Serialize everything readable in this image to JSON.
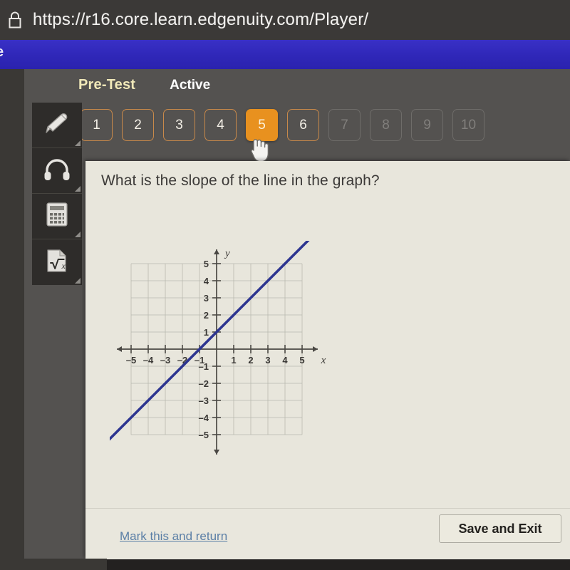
{
  "browser": {
    "url": "https://r16.core.learn.edgenuity.com/Player/",
    "lock_icon": "lock-icon"
  },
  "banner": {
    "cutoff_text": "e"
  },
  "test_header": {
    "title": "Pre-Test",
    "status": "Active"
  },
  "question_nav": {
    "items": [
      {
        "label": "1",
        "state": "available"
      },
      {
        "label": "2",
        "state": "available"
      },
      {
        "label": "3",
        "state": "available"
      },
      {
        "label": "4",
        "state": "available"
      },
      {
        "label": "5",
        "state": "current"
      },
      {
        "label": "6",
        "state": "available"
      },
      {
        "label": "7",
        "state": "locked"
      },
      {
        "label": "8",
        "state": "locked"
      },
      {
        "label": "9",
        "state": "locked"
      },
      {
        "label": "10",
        "state": "locked"
      }
    ],
    "current_index": 4
  },
  "tools": [
    {
      "name": "pencil-tool",
      "icon": "pencil-icon"
    },
    {
      "name": "audio-tool",
      "icon": "headphones-icon"
    },
    {
      "name": "calculator-tool",
      "icon": "calculator-icon"
    },
    {
      "name": "formula-tool",
      "icon": "square-root-icon"
    }
  ],
  "question": {
    "text": "What is the slope of the line in the graph?"
  },
  "footer": {
    "mark_link": "Mark this and return",
    "save_button": "Save and Exit"
  },
  "colors": {
    "accent_orange": "#e8911f",
    "banner_blue": "#2f27b8",
    "line_blue": "#2d3590",
    "link_blue": "#5b7fa6"
  },
  "chart_data": {
    "type": "line",
    "title": "",
    "xlabel": "x",
    "ylabel": "y",
    "xlim": [
      -5,
      5
    ],
    "ylim": [
      -5,
      5
    ],
    "grid": true,
    "legend": "none",
    "x_ticks": [
      -5,
      -4,
      -3,
      -2,
      -1,
      1,
      2,
      3,
      4,
      5
    ],
    "y_ticks": [
      5,
      4,
      3,
      2,
      1,
      -1,
      -2,
      -3,
      -4,
      -5
    ],
    "x_tick_labels": [
      "–5",
      "–4",
      "–3",
      "–2",
      "–1",
      "1",
      "2",
      "3",
      "4",
      "5"
    ],
    "y_tick_labels": [
      "5",
      "4",
      "3",
      "2",
      "1",
      "–1",
      "–2",
      "–3",
      "–4",
      "–5"
    ],
    "series": [
      {
        "name": "line",
        "color": "#2d3590",
        "slope": 1,
        "intercept": 1,
        "x": [
          -6.3,
          5.6
        ],
        "y": [
          -5.3,
          6.6
        ],
        "points_on_axes": [
          [
            -1,
            0
          ],
          [
            0,
            1
          ]
        ]
      }
    ]
  }
}
